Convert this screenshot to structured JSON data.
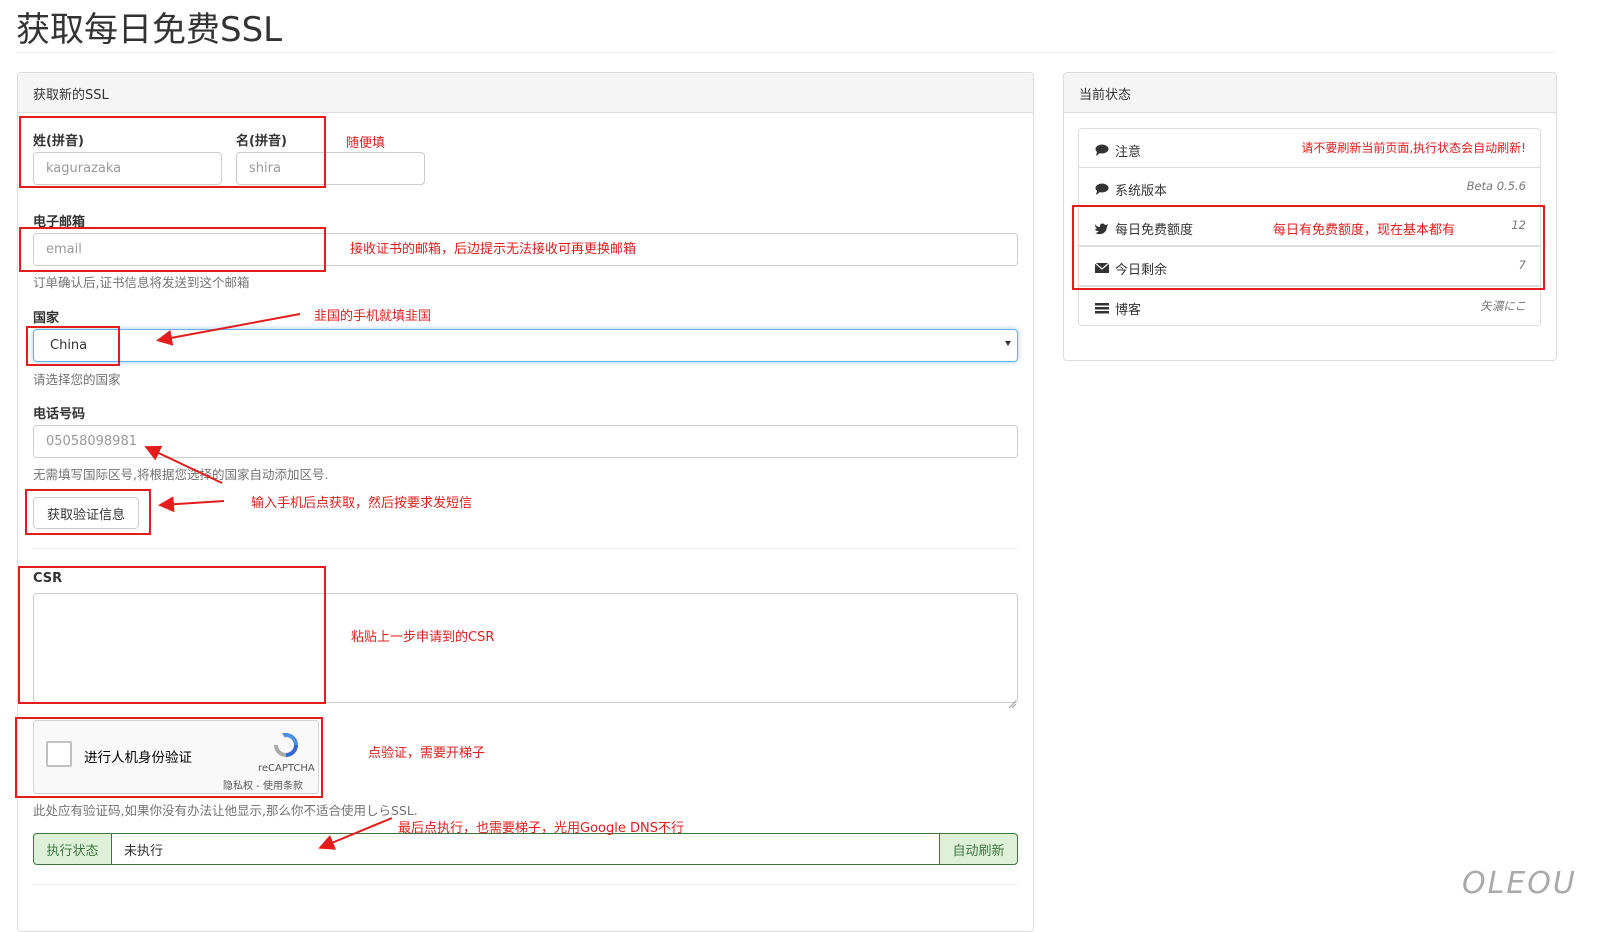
{
  "page": {
    "title": "获取每日免费SSL"
  },
  "form_panel": {
    "heading": "获取新的SSL",
    "first_name": {
      "label": "姓(拼音)",
      "placeholder": "kagurazaka"
    },
    "last_name": {
      "label": "名(拼音)",
      "placeholder": "shira"
    },
    "email": {
      "label": "电子邮箱",
      "placeholder": "email",
      "help": "订单确认后,证书信息将发送到这个邮箱"
    },
    "country": {
      "label": "国家",
      "value": "China",
      "help": "请选择您的国家"
    },
    "phone": {
      "label": "电话号码",
      "placeholder": "05058098981",
      "help": "无需填写国际区号,将根据您选择的国家自动添加区号."
    },
    "get_code_button": "获取验证信息",
    "csr": {
      "label": "CSR",
      "value": ""
    },
    "recaptcha": {
      "checkbox_label": "进行人机身份验证",
      "brand": "reCAPTCHA",
      "links": "隐私权 - 使用条款"
    },
    "captcha_help": "此处应有验证码,如果你没有办法让他显示,那么你不适合使用しらSSL.",
    "status": {
      "addon_label": "执行状态",
      "value": "未执行",
      "refresh_label": "自动刷新"
    }
  },
  "status_panel": {
    "heading": "当前状态",
    "items": [
      {
        "icon": "comment-icon",
        "label": "注意",
        "value": "请不要刷新当前页面,执行状态会自动刷新!"
      },
      {
        "icon": "comment-icon",
        "label": "系统版本",
        "value": "Beta 0.5.6"
      },
      {
        "icon": "twitter-icon",
        "label": "每日免费额度",
        "value": "12"
      },
      {
        "icon": "envelope-icon",
        "label": "今日剩余",
        "value": "7"
      },
      {
        "icon": "list-icon",
        "label": "博客",
        "value": "矢濃にこ"
      }
    ]
  },
  "annotations": {
    "name": "随便填",
    "email": "接收证书的邮箱，后边提示无法接收可再更换邮箱",
    "country": "韭国的手机就填韭国",
    "get_code": "输入手机后点获取，然后按要求发短信",
    "csr": "粘贴上一步申请到的CSR",
    "captcha": "点验证，需要开梯子",
    "execute": "最后点执行，也需要梯子，光用Google DNS不行",
    "quota": "每日有免费额度，现在基本都有"
  },
  "watermark": "OLEOU",
  "colors": {
    "annotation_red": "#e41c1c",
    "focus_blue": "#66afe9",
    "success_green": "#3c763d",
    "success_bg": "#dff0d8"
  }
}
